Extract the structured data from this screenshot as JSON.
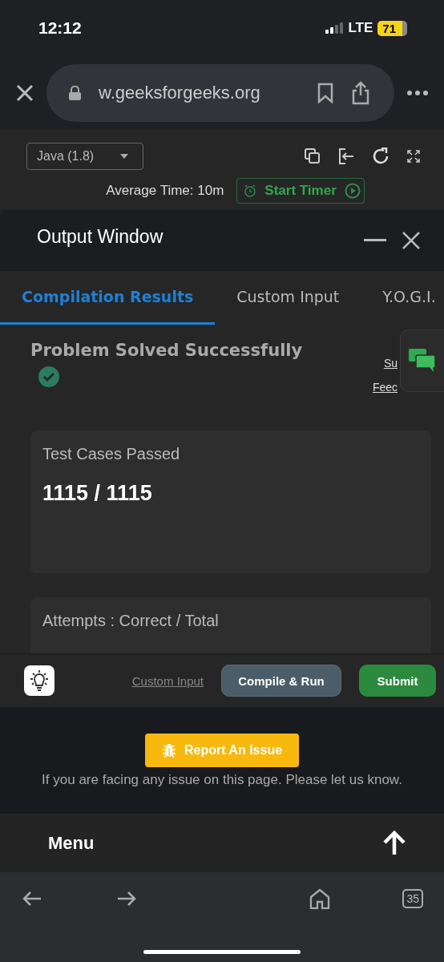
{
  "status_bar": {
    "time": "12:12",
    "network": "LTE",
    "battery": "71"
  },
  "browser": {
    "url": "w.geeksforgeeks.org",
    "tab_count": "35"
  },
  "editor": {
    "language": "Java (1.8)",
    "average_time": "Average Time: 10m",
    "timer_button": "Start Timer"
  },
  "output_window": {
    "title": "Output Window",
    "tabs": [
      {
        "label": "Compilation Results",
        "selected": true
      },
      {
        "label": "Custom Input",
        "selected": false
      },
      {
        "label": "Y.O.G.I.",
        "selected": false
      }
    ],
    "result": "Problem Solved Successfully",
    "side_links": [
      "Su",
      "Feec"
    ],
    "cards": [
      {
        "label": "Test Cases Passed",
        "value": "1115 / 1115"
      },
      {
        "label": "Attempts : Correct / Total"
      }
    ]
  },
  "actions": {
    "link": "Custom Input",
    "compile": "Compile & Run",
    "submit": "Submit"
  },
  "report": {
    "button": "Report An Issue",
    "note": "If you are facing any issue on this page. Please let us know."
  },
  "menu": {
    "label": "Menu"
  }
}
